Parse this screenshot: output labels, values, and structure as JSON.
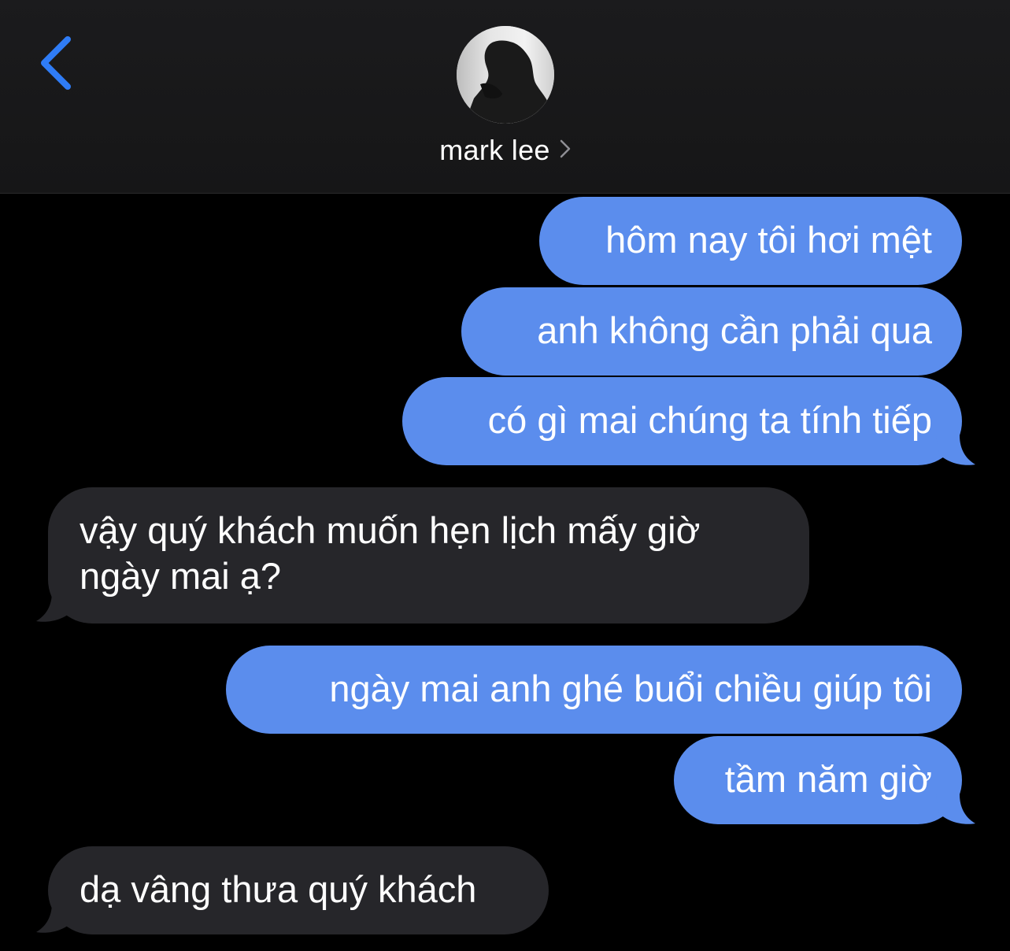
{
  "header": {
    "back_icon": "chevron-left-icon",
    "contact_name": "mark lee",
    "contact_chevron_icon": "chevron-right-icon",
    "accent_color": "#2f7cf6"
  },
  "conversation": {
    "outgoing_color": "#5b8ded",
    "incoming_color": "#26262a",
    "messages": [
      {
        "direction": "outgoing",
        "text": "hôm nay tôi hơi mệt"
      },
      {
        "direction": "outgoing",
        "text": "anh không cần phải qua"
      },
      {
        "direction": "outgoing",
        "text": "có gì mai chúng ta tính tiếp"
      },
      {
        "direction": "incoming",
        "lines": [
          "vậy quý khách muốn hẹn lịch mấy giờ",
          "ngày mai ạ?"
        ]
      },
      {
        "direction": "outgoing",
        "text": "ngày mai anh ghé buổi chiều giúp tôi"
      },
      {
        "direction": "outgoing",
        "text": "tầm năm giờ"
      },
      {
        "direction": "incoming",
        "text": "dạ vâng thưa quý khách"
      }
    ]
  }
}
